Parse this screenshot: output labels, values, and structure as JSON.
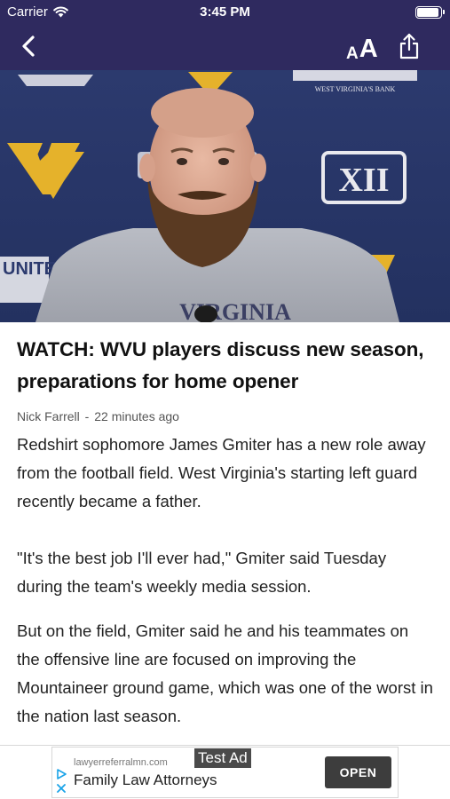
{
  "status_bar": {
    "carrier": "Carrier",
    "time": "3:45 PM",
    "battery_level": 0.95
  },
  "nav": {
    "back_icon": "chevron-left-icon",
    "font_size_small": "A",
    "font_size_large": "A",
    "share_icon": "share-icon",
    "bar_color": "#2f2a5f"
  },
  "hero": {
    "banner_text_top_right": "WEST VIRGINIA'S BANK",
    "banner_text_left": "UNITED BANK",
    "shirt_text": "VIRGINIA",
    "conference_logo": "XII"
  },
  "article": {
    "headline": "WATCH: WVU players discuss new season, preparations for home opener",
    "author": "Nick Farrell",
    "separator": "-",
    "published": "22 minutes ago",
    "paragraphs": [
      "Redshirt sophomore James Gmiter has a new role away from the football field. West Virginia's starting left guard recently became a father.",
      "\"It's the best job I'll ever had,\" Gmiter said Tuesday during the team's weekly media session.",
      "But on the field, Gmiter said he and his teammates on the offensive line are focused on improving the Mountaineer ground game, which was one of the worst in the nation last season."
    ]
  },
  "ad": {
    "label": "Test Ad",
    "url": "lawyerreferralmn.com",
    "title": "Family Law Attorneys",
    "cta": "OPEN"
  }
}
